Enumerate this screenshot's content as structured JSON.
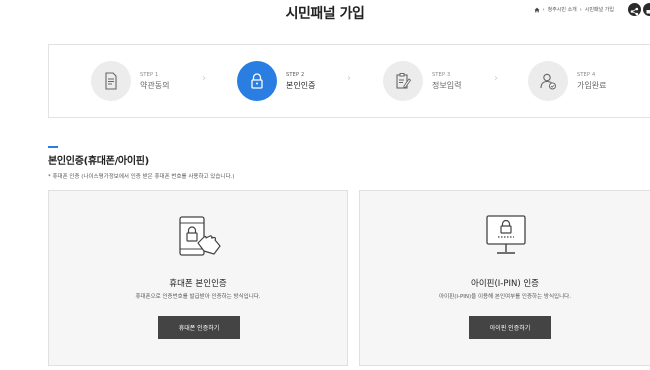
{
  "header": {
    "title": "시민패널 가입",
    "breadcrumb": [
      "청주시민 소개",
      "시민패널 가입"
    ],
    "share_icon": "share-icon",
    "print_icon": "print-icon"
  },
  "steps": [
    {
      "num": "STEP 1",
      "label": "약관동의",
      "icon": "document-icon",
      "active": false
    },
    {
      "num": "STEP 2",
      "label": "본인인증",
      "icon": "lock-icon",
      "active": true
    },
    {
      "num": "STEP 3",
      "label": "정보입력",
      "icon": "clipboard-edit-icon",
      "active": false
    },
    {
      "num": "STEP 4",
      "label": "가입완료",
      "icon": "user-check-icon",
      "active": false
    }
  ],
  "section": {
    "title": "본인인증(휴대폰/아이핀)",
    "note": "* 휴대폰 인증 (나이스평가정보에서 인증 받은 휴대폰 번호를 사용하고 있습니다.)"
  },
  "cards": {
    "phone": {
      "title": "휴대폰 본인인증",
      "desc": "휴대폰으로 인증번호를 발급받아 인증하는 방식입니다.",
      "button": "휴대폰 인증하기"
    },
    "ipin": {
      "title": "아이핀(I-PIN) 인증",
      "desc": "아이핀(I-PIN)을 이용해 본인여부를 인증하는 방식입니다.",
      "button": "아이핀 인증하기"
    }
  },
  "colors": {
    "accent": "#2a7de1",
    "button": "#444444",
    "card_bg": "#f6f6f6"
  }
}
